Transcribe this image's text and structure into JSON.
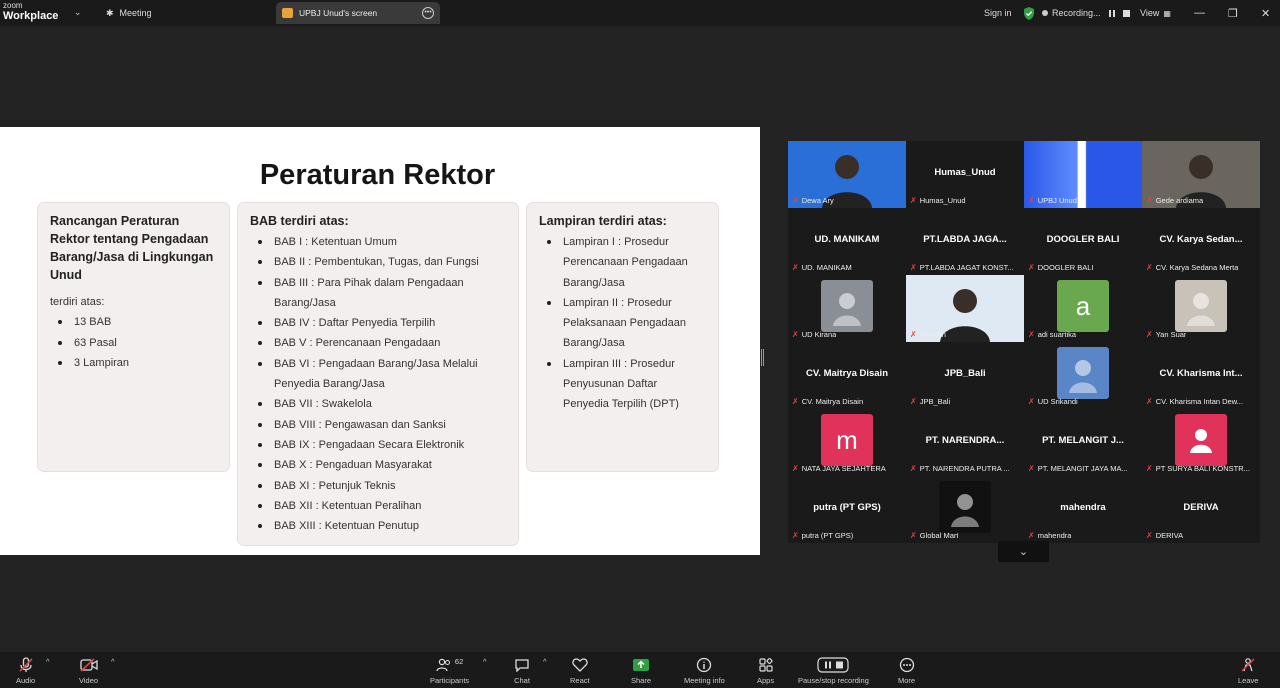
{
  "topbar": {
    "brand_line1": "zoom",
    "brand_line2": "Workplace",
    "meeting_tab": "Meeting",
    "share_tab": "UPBJ Unud's screen",
    "sign_in": "Sign in",
    "recording": "Recording...",
    "view": "View"
  },
  "slide": {
    "title": "Peraturan Rektor",
    "card1": {
      "heading": "Rancangan Peraturan Rektor tentang Pengadaan Barang/Jasa di Lingkungan Unud",
      "sub": "terdiri atas:",
      "items": [
        "13 BAB",
        "63 Pasal",
        "3 Lampiran"
      ]
    },
    "card2": {
      "heading": "BAB terdiri atas:",
      "items": [
        "BAB I : Ketentuan Umum",
        "BAB II : Pembentukan, Tugas, dan Fungsi",
        "BAB III : Para Pihak dalam Pengadaan Barang/Jasa",
        "BAB IV : Daftar Penyedia Terpilih",
        "BAB V : Perencanaan Pengadaan",
        "BAB VI : Pengadaan Barang/Jasa Melalui Penyedia Barang/Jasa",
        "BAB VII : Swakelola",
        "BAB VIII : Pengawasan dan Sanksi",
        "BAB IX : Pengadaan Secara Elektronik",
        "BAB X : Pengaduan Masyarakat",
        "BAB XI : Petunjuk Teknis",
        "BAB XII : Ketentuan Peralihan",
        "BAB XIII : Ketentuan Penutup"
      ]
    },
    "card3": {
      "heading": "Lampiran terdiri atas:",
      "items": [
        "Lampiran I : Prosedur Perencanaan Pengadaan Barang/Jasa",
        "Lampiran II : Prosedur Pelaksanaan Pengadaan Barang/Jasa",
        "Lampiran III : Prosedur Penyusunan Daftar Penyedia Terpilih (DPT)"
      ]
    }
  },
  "participants": [
    {
      "name": "Dewa Ary",
      "big": "",
      "kind": "video-person",
      "color": "#2a6fd8"
    },
    {
      "name": "Humas_Unud",
      "big": "Humas_Unud",
      "kind": "name"
    },
    {
      "name": "UPBJ Unud",
      "big": "",
      "kind": "video-slide",
      "color": "#2b57e8"
    },
    {
      "name": "Gede ardiama",
      "big": "",
      "kind": "video-person",
      "color": "#6b6560"
    },
    {
      "name": "UD. MANIKAM",
      "big": "UD. MANIKAM",
      "kind": "name"
    },
    {
      "name": "PT.LABDA JAGAT KONST...",
      "big": "PT.LABDA JAGA...",
      "kind": "name"
    },
    {
      "name": "DOOGLER BALI",
      "big": "DOOGLER BALI",
      "kind": "name"
    },
    {
      "name": "CV. Karya Sedana Merta",
      "big": "CV. Karya Sedan...",
      "kind": "name"
    },
    {
      "name": "UD Kirana",
      "big": "",
      "kind": "avatar-photo",
      "color": "#8a8f96"
    },
    {
      "name": "ariawan",
      "big": "",
      "kind": "video-person",
      "color": "#dfe9f3"
    },
    {
      "name": "adi suartika",
      "big": "a",
      "kind": "avatar-letter",
      "color": "#6aa84f"
    },
    {
      "name": "Yan Suar",
      "big": "",
      "kind": "avatar-photo",
      "color": "#c9c2b8"
    },
    {
      "name": "CV. Maitrya Disain",
      "big": "CV. Maitrya Disain",
      "kind": "name"
    },
    {
      "name": "JPB_Bali",
      "big": "JPB_Bali",
      "kind": "name"
    },
    {
      "name": "UD Srikandi",
      "big": "",
      "kind": "avatar-photo",
      "color": "#5a86c8"
    },
    {
      "name": "CV. Kharisma Intan Dew...",
      "big": "CV. Kharisma Int...",
      "kind": "name"
    },
    {
      "name": "NATA JAYA SEJAHTERA",
      "big": "m",
      "kind": "avatar-letter",
      "color": "#e0325a"
    },
    {
      "name": "PT. NARENDRA PUTRA ...",
      "big": "PT. NARENDRA...",
      "kind": "name"
    },
    {
      "name": "PT. MELANGIT JAYA MA...",
      "big": "PT. MELANGIT J...",
      "kind": "name"
    },
    {
      "name": "PT SURYA BALI KONSTR...",
      "big": "",
      "kind": "avatar-person",
      "color": "#e0325a"
    },
    {
      "name": "putra (PT GPS)",
      "big": "putra (PT GPS)",
      "kind": "name"
    },
    {
      "name": "Global Mart",
      "big": "",
      "kind": "avatar-photo",
      "color": "#111111"
    },
    {
      "name": "mahendra",
      "big": "mahendra",
      "kind": "name"
    },
    {
      "name": "DERIVA",
      "big": "DERIVA",
      "kind": "name"
    }
  ],
  "bottombar": {
    "audio": "Audio",
    "video": "Video",
    "participants": "Participants",
    "participant_count": "62",
    "chat": "Chat",
    "react": "React",
    "share": "Share",
    "meeting_info": "Meeting info",
    "apps": "Apps",
    "pause_stop": "Pause/stop recording",
    "more": "More",
    "leave": "Leave"
  }
}
